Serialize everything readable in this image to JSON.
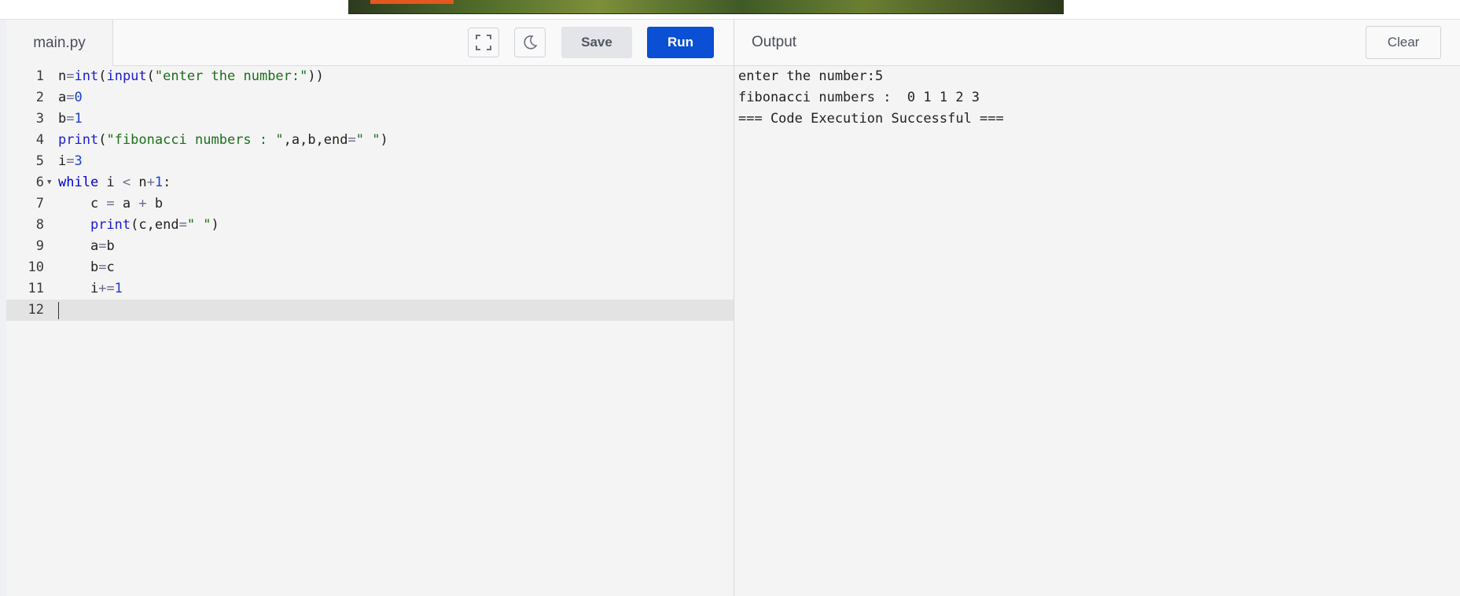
{
  "editor": {
    "file_tab": "main.py",
    "save_label": "Save",
    "run_label": "Run",
    "fullscreen_icon": "fullscreen-icon",
    "theme_icon": "moon-icon",
    "active_line": 12,
    "lines": [
      {
        "num": "1",
        "code": "n=int(input(\"enter the number:\"))"
      },
      {
        "num": "2",
        "code": "a=0"
      },
      {
        "num": "3",
        "code": "b=1"
      },
      {
        "num": "4",
        "code": "print(\"fibonacci numbers : \",a,b,end=\" \")"
      },
      {
        "num": "5",
        "code": "i=3"
      },
      {
        "num": "6",
        "code": "while i < n+1:"
      },
      {
        "num": "7",
        "code": "    c = a + b"
      },
      {
        "num": "8",
        "code": "    print(c,end=\" \")"
      },
      {
        "num": "9",
        "code": "    a=b"
      },
      {
        "num": "10",
        "code": "    b=c"
      },
      {
        "num": "11",
        "code": "    i+=1"
      },
      {
        "num": "12",
        "code": ""
      }
    ]
  },
  "output": {
    "title": "Output",
    "clear_label": "Clear",
    "lines": [
      "enter the number:5",
      "fibonacci numbers :  0 1 1 2 3",
      "=== Code Execution Successful ==="
    ]
  },
  "colors": {
    "run_button": "#0a4fd4",
    "keyword": "#0000d0",
    "string": "#1c6e1c",
    "number": "#1b3fcf"
  }
}
